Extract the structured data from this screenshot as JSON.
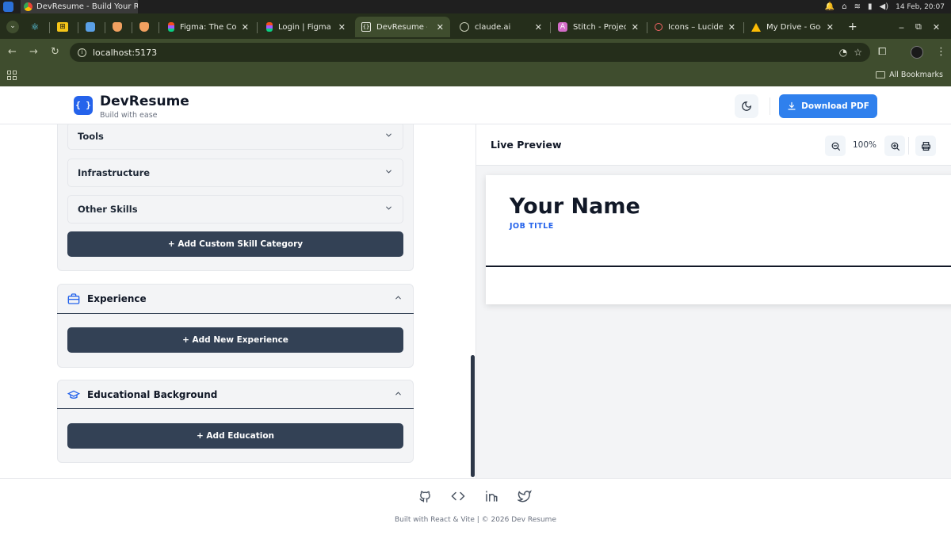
{
  "os_bar": {
    "window_title": "DevResume - Build Your Res...",
    "clock": "14 Feb, 20:07"
  },
  "browser": {
    "tabs": [
      {
        "title": "",
        "icon": "react-icon"
      },
      {
        "title": "",
        "icon": "yellow-app-icon"
      },
      {
        "title": "",
        "icon": "blue-app-icon"
      },
      {
        "title": "",
        "icon": "brave-icon"
      },
      {
        "title": "",
        "icon": "brave-icon"
      },
      {
        "title": "Figma: The Colla",
        "icon": "figma-icon"
      },
      {
        "title": "Login | Figma",
        "icon": "figma-icon"
      },
      {
        "title": "DevResume - Bu",
        "icon": "braces-icon",
        "active": true
      },
      {
        "title": "claude.ai",
        "icon": "globe-icon"
      },
      {
        "title": "Stitch - Projects",
        "icon": "stitch-icon"
      },
      {
        "title": "Icons – Lucide",
        "icon": "lucide-icon"
      },
      {
        "title": "My Drive - Goog",
        "icon": "drive-icon"
      }
    ],
    "new_tab": "+",
    "url": "localhost:5173",
    "bookmarks_label": "All Bookmarks"
  },
  "header": {
    "logo_glyph": "{ }",
    "brand": "DevResume",
    "tagline": "Build with ease",
    "download_label": "Download PDF",
    "accent": "#2f80ed"
  },
  "editor": {
    "skills": {
      "categories": [
        "Tools",
        "Infrastructure",
        "Other Skills"
      ],
      "add_label": "+ Add Custom Skill Category"
    },
    "experience": {
      "title": "Experience",
      "add_label": "+ Add New Experience"
    },
    "education": {
      "title": "Educational Background",
      "add_label": "+ Add Education"
    }
  },
  "preview": {
    "title": "Live Preview",
    "zoom": "100%",
    "resume_name": "Your Name",
    "resume_job": "JOB TITLE"
  },
  "footer": {
    "icons": [
      "github-icon",
      "code-icon",
      "linkedin-icon",
      "twitter-icon"
    ],
    "text": "Built with React & Vite | © 2026 Dev Resume"
  }
}
